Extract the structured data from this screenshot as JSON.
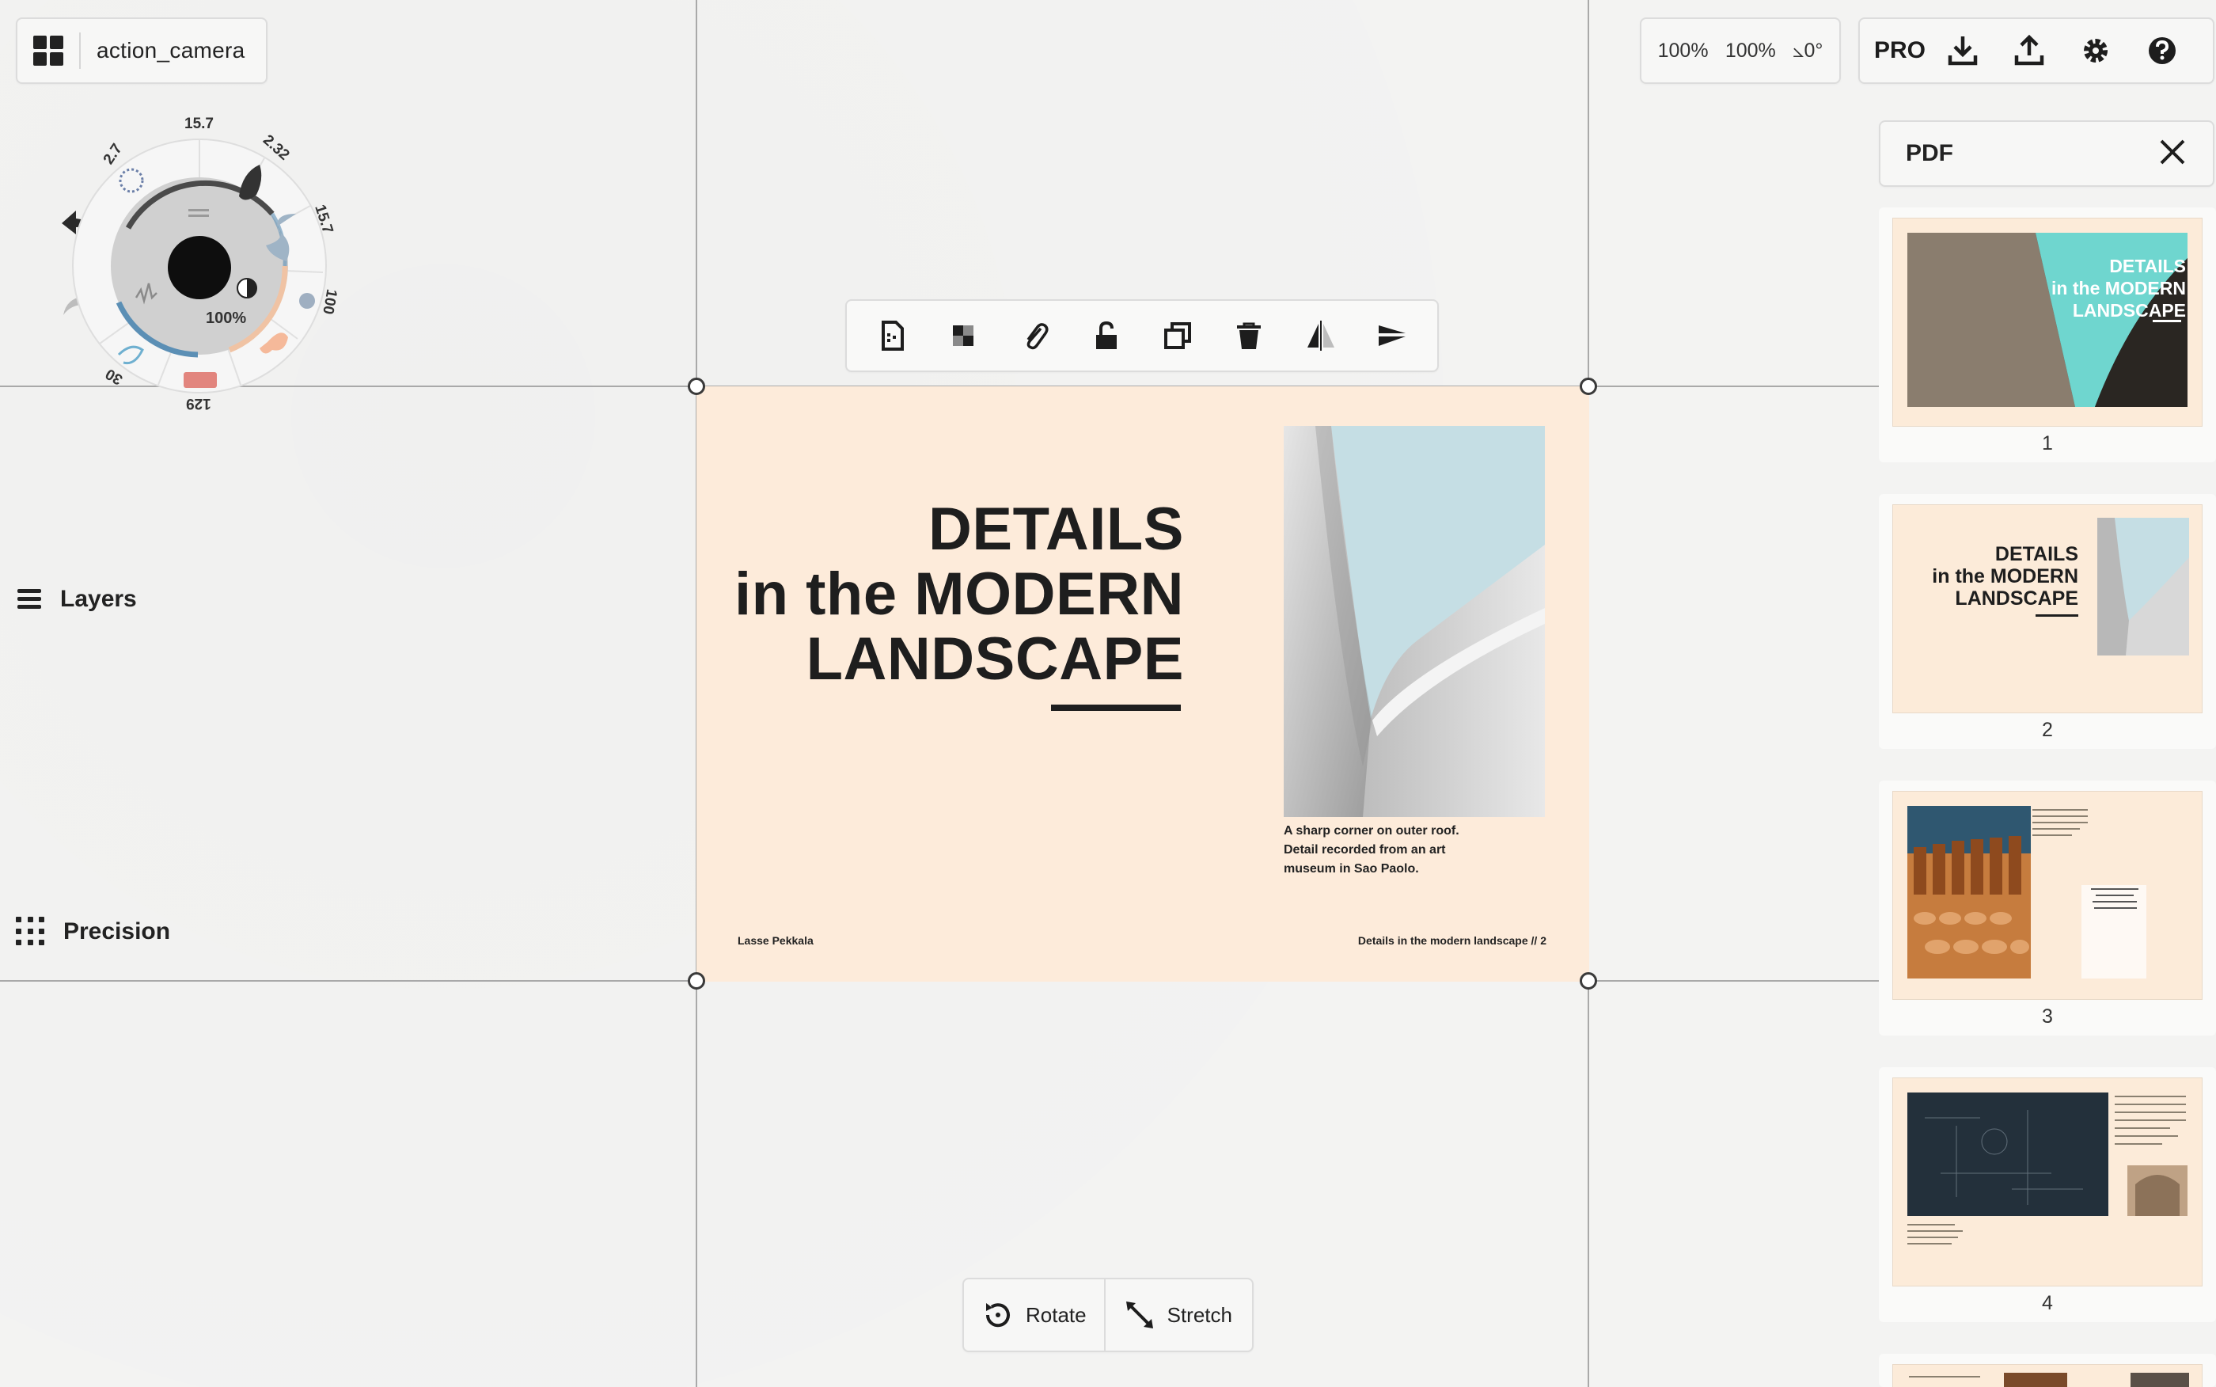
{
  "app": {
    "file_name": "action_camera"
  },
  "wheel": {
    "labels": {
      "top": "15.7",
      "top_right": "2.32",
      "right_upper": "15.7",
      "right_lower": "100",
      "bottom": "129",
      "bottom_left": "30",
      "top_left": "2.7"
    },
    "opacity": "100%"
  },
  "left_panel": {
    "layers_label": "Layers",
    "precision_label": "Precision"
  },
  "zoom": {
    "scale_x": "100%",
    "scale_y": "100%",
    "rotation": "⦣0°"
  },
  "toolbar": {
    "pro_label": "PRO"
  },
  "pdf_panel": {
    "title": "PDF",
    "pages": [
      "1",
      "2",
      "3",
      "4"
    ],
    "thumb1": {
      "title_l1": "DETAILS",
      "title_l2": "in the MODERN",
      "title_l3": "LANDSCAPE"
    },
    "thumb2": {
      "title_l1": "DETAILS",
      "title_l2": "in the MODERN",
      "title_l3": "LANDSCAPE"
    }
  },
  "slide": {
    "title_l1": "DETAILS",
    "title_l2": "in the MODERN",
    "title_l3": "LANDSCAPE",
    "caption_l1": "A sharp corner on outer roof.",
    "caption_l2": "Detail recorded from an art",
    "caption_l3": "museum in Sao Paolo.",
    "footer_left": "Lasse Pekkala",
    "footer_right": "Details in the modern landscape // 2"
  },
  "transform": {
    "rotate_label": "Rotate",
    "stretch_label": "Stretch"
  },
  "colors": {
    "slide_bg": "#fdebda",
    "accent_teal": "#6fd6cf",
    "wheel_blue": "#5b8fb5"
  }
}
